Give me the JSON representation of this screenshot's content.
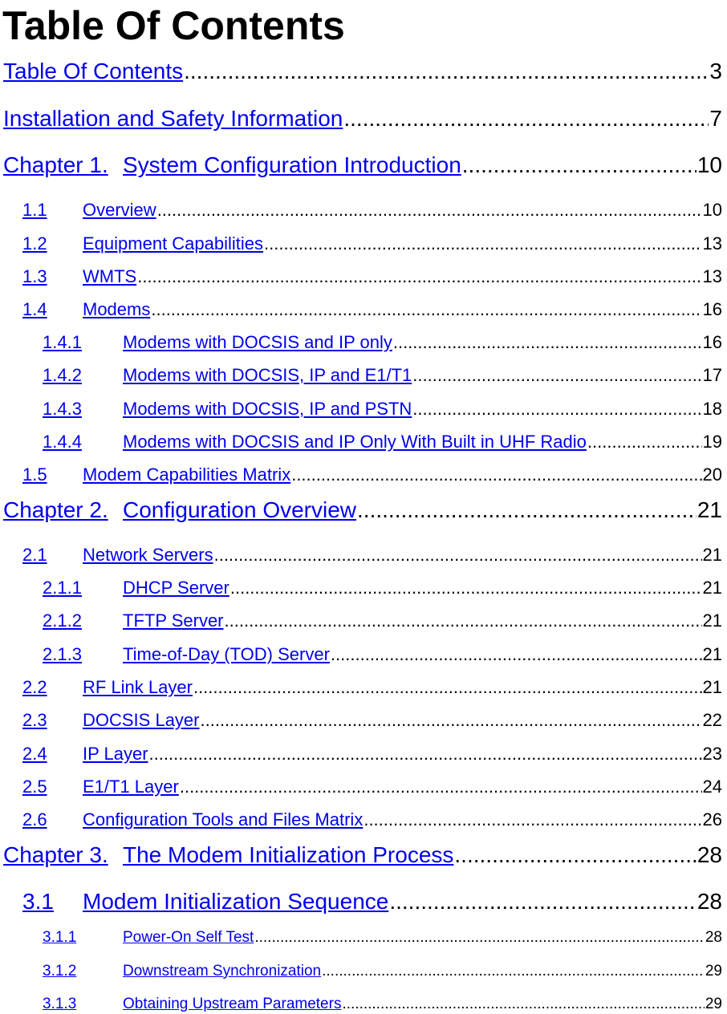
{
  "heading": "Table Of Contents",
  "link_color": "#0000ee",
  "entries": [
    {
      "level": "top",
      "num": "",
      "title": "Table Of Contents",
      "page": "3"
    },
    {
      "level": "top",
      "num": "",
      "title": "Installation and Safety Information",
      "page": "7"
    },
    {
      "level": "chapter",
      "num": "Chapter 1.",
      "title": "System Configuration Introduction",
      "page": "10"
    },
    {
      "level": "section",
      "num": "1.1",
      "title": "Overview",
      "page": "10"
    },
    {
      "level": "section",
      "num": "1.2",
      "title": "Equipment Capabilities",
      "page": "13"
    },
    {
      "level": "section",
      "num": "1.3",
      "title": "WMTS",
      "page": "13"
    },
    {
      "level": "section",
      "num": "1.4",
      "title": "Modems",
      "page": "16"
    },
    {
      "level": "subsection",
      "num": "1.4.1",
      "title": "Modems with DOCSIS and IP only",
      "page": "16"
    },
    {
      "level": "subsection",
      "num": "1.4.2",
      "title": "Modems with DOCSIS, IP and E1/T1",
      "page": "17"
    },
    {
      "level": "subsection",
      "num": "1.4.3",
      "title": "Modems with DOCSIS, IP and PSTN",
      "page": "18"
    },
    {
      "level": "subsection",
      "num": "1.4.4",
      "title": "Modems with DOCSIS and IP Only With Built in UHF Radio",
      "page": "19"
    },
    {
      "level": "section",
      "num": "1.5",
      "title": "Modem Capabilities Matrix",
      "page": "20"
    },
    {
      "level": "chapter",
      "num": "Chapter 2.",
      "title": "Configuration Overview",
      "page": "21"
    },
    {
      "level": "section",
      "num": "2.1",
      "title": "Network Servers",
      "page": "21"
    },
    {
      "level": "subsection",
      "num": "2.1.1",
      "title": "DHCP Server",
      "page": "21"
    },
    {
      "level": "subsection",
      "num": "2.1.2",
      "title": "TFTP Server",
      "page": "21"
    },
    {
      "level": "subsection",
      "num": "2.1.3",
      "title": "Time-of-Day (TOD) Server",
      "page": "21"
    },
    {
      "level": "section",
      "num": "2.2",
      "title": "RF Link Layer",
      "page": "21"
    },
    {
      "level": "section",
      "num": "2.3",
      "title": "DOCSIS Layer",
      "page": "22"
    },
    {
      "level": "section",
      "num": "2.4",
      "title": "IP Layer",
      "page": "23"
    },
    {
      "level": "section",
      "num": "2.5",
      "title": "E1/T1 Layer",
      "page": "24"
    },
    {
      "level": "section",
      "num": "2.6",
      "title": "Configuration Tools and Files Matrix",
      "page": "26"
    },
    {
      "level": "chapter",
      "num": "Chapter 3.",
      "title": "The Modem Initialization Process",
      "page": "28"
    },
    {
      "level": "section-large",
      "num": "3.1",
      "title": "Modem Initialization Sequence",
      "page": "28"
    },
    {
      "level": "subsection-small",
      "num": "3.1.1",
      "title": "Power-On Self Test",
      "page": "28"
    },
    {
      "level": "subsection-small",
      "num": "3.1.2",
      "title": "Downstream Synchronization",
      "page": "29"
    },
    {
      "level": "subsection-small",
      "num": "3.1.3",
      "title": "Obtaining Upstream Parameters",
      "page": "29"
    }
  ]
}
